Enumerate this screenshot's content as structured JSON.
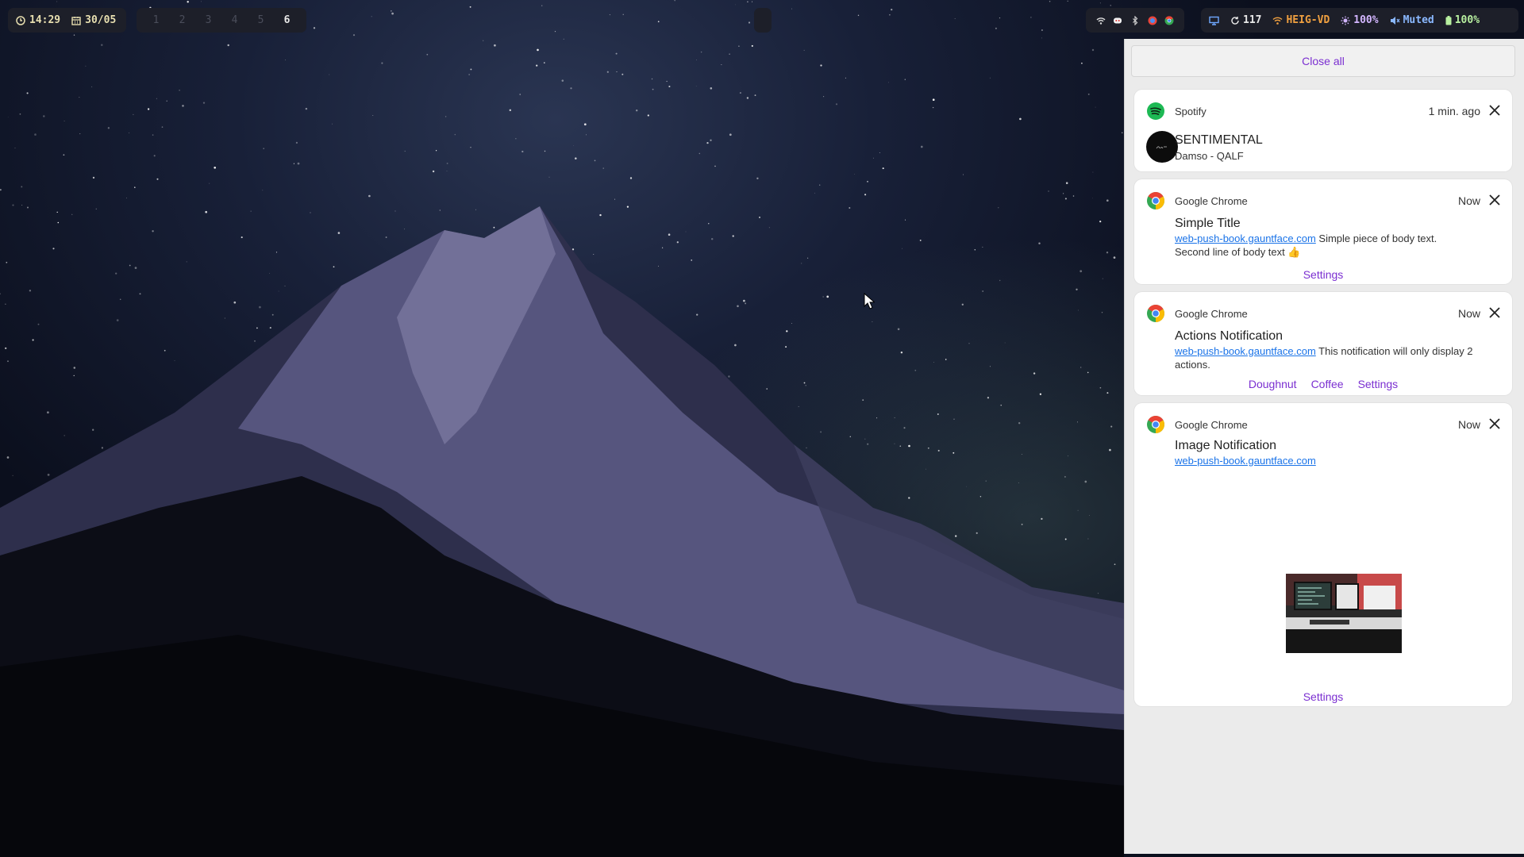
{
  "topbar": {
    "time": "14:29",
    "date": "30/05",
    "workspaces": [
      "1",
      "2",
      "3",
      "4",
      "5",
      "6"
    ],
    "active_workspace": "6",
    "status": {
      "updates": "117",
      "network": "HEIG-VD",
      "brightness": "100%",
      "volume": "Muted",
      "battery": "100%"
    }
  },
  "panel": {
    "close_all_label": "Close all",
    "notifications": [
      {
        "app": "Spotify",
        "icon": "spotify-icon",
        "time": "1 min. ago",
        "title": "SENTIMENTAL",
        "body": "Damso - QALF"
      },
      {
        "app": "Google Chrome",
        "icon": "chrome-icon",
        "time": "Now",
        "title": "Simple Title",
        "link": "web-push-book.gauntface.com",
        "body": "Simple piece of body text.",
        "body2": "Second line of body text 👍",
        "actions": [
          "Settings"
        ]
      },
      {
        "app": "Google Chrome",
        "icon": "chrome-icon",
        "time": "Now",
        "title": "Actions Notification",
        "link": "web-push-book.gauntface.com",
        "body": "This notification will only display 2 actions.",
        "actions": [
          "Doughnut",
          "Coffee",
          "Settings"
        ]
      },
      {
        "app": "Google Chrome",
        "icon": "chrome-icon",
        "time": "Now",
        "title": "Image Notification",
        "link": "web-push-book.gauntface.com",
        "actions": [
          "Settings"
        ]
      }
    ]
  }
}
